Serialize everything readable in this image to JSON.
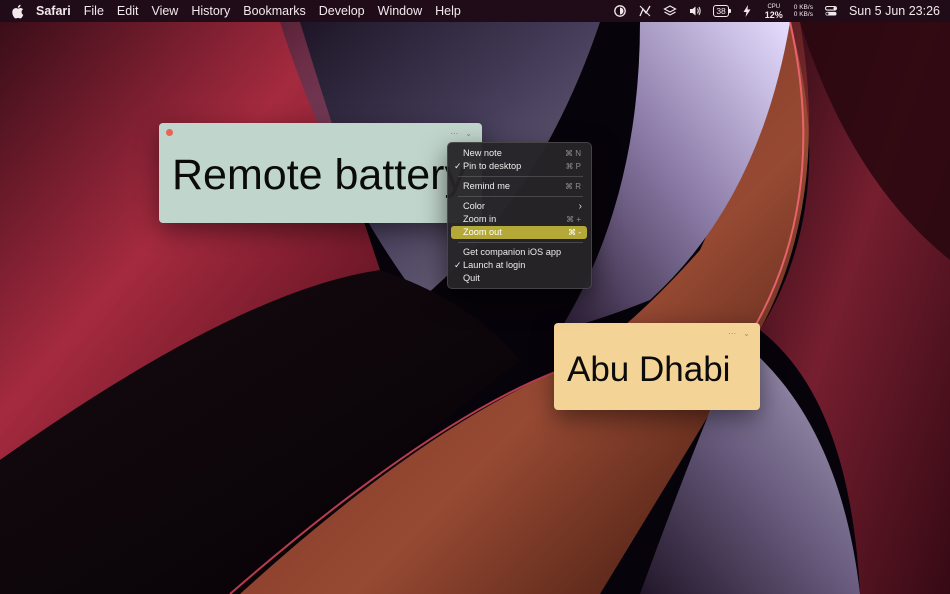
{
  "menubar": {
    "apple_icon": "apple-logo",
    "app_name": "Safari",
    "items": [
      "File",
      "Edit",
      "View",
      "History",
      "Bookmarks",
      "Develop",
      "Window",
      "Help"
    ],
    "status": {
      "battery_level": "38",
      "cpu_label": "CPU",
      "cpu_value": "12%",
      "net_up": "0 KB/s",
      "net_down": "0 KB/s",
      "datetime": "Sun 5 Jun  23:26"
    }
  },
  "notes": [
    {
      "text": "Remote battery",
      "color": "#c0d5cb"
    },
    {
      "text": "Abu Dhabi",
      "color": "#f4d397"
    }
  ],
  "context_menu": {
    "items": [
      {
        "label": "New note",
        "shortcut": "⌘ N",
        "checked": false
      },
      {
        "label": "Pin to desktop",
        "shortcut": "⌘ P",
        "checked": true
      },
      {
        "label": "Remind me",
        "shortcut": "⌘ R",
        "checked": false
      },
      {
        "label": "Color",
        "shortcut": "",
        "checked": false,
        "submenu": true
      },
      {
        "label": "Zoom in",
        "shortcut": "⌘ +",
        "checked": false
      },
      {
        "label": "Zoom out",
        "shortcut": "⌘ -",
        "checked": false,
        "highlighted": true
      },
      {
        "label": "Get companion iOS app",
        "shortcut": "",
        "checked": false
      },
      {
        "label": "Launch at login",
        "shortcut": "",
        "checked": true
      },
      {
        "label": "Quit",
        "shortcut": "",
        "checked": false
      }
    ],
    "check_glyph": "✓",
    "submenu_glyph": "›",
    "highlight_color": "#b4a938"
  },
  "icons": {
    "note_more": "⋯",
    "note_collapse": "⌄"
  }
}
